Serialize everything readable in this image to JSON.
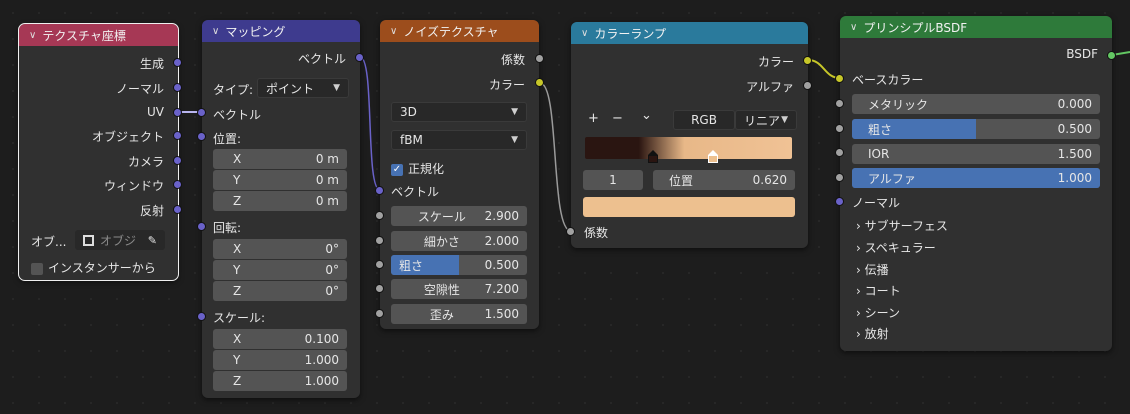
{
  "texcoord": {
    "title": "テクスチャ座標",
    "color": "#a63855",
    "outputs": [
      "生成",
      "ノーマル",
      "UV",
      "オブジェクト",
      "カメラ",
      "ウィンドウ",
      "反射"
    ],
    "object_label": "オブ...",
    "object_placeholder": "オブジ",
    "instancer_label": "インスタンサーから"
  },
  "mapping": {
    "title": "マッピング",
    "color": "#3e3b8e",
    "out_vector": "ベクトル",
    "type_label": "タイプ:",
    "type_value": "ポイント",
    "in_vector": "ベクトル",
    "location_label": "位置:",
    "location": [
      {
        "axis": "X",
        "value": "0 m"
      },
      {
        "axis": "Y",
        "value": "0 m"
      },
      {
        "axis": "Z",
        "value": "0 m"
      }
    ],
    "rotation_label": "回転:",
    "rotation": [
      {
        "axis": "X",
        "value": "0°"
      },
      {
        "axis": "Y",
        "value": "0°"
      },
      {
        "axis": "Z",
        "value": "0°"
      }
    ],
    "scale_label": "スケール:",
    "scale": [
      {
        "axis": "X",
        "value": "0.100"
      },
      {
        "axis": "Y",
        "value": "1.000"
      },
      {
        "axis": "Z",
        "value": "1.000"
      }
    ]
  },
  "noise": {
    "title": "ノイズテクスチャ",
    "color": "#9c4d1c",
    "out_fac": "係数",
    "out_color": "カラー",
    "dim": "3D",
    "type": "fBM",
    "normalize_label": "正規化",
    "in_vector": "ベクトル",
    "fields": [
      {
        "label": "スケール",
        "value": "2.900"
      },
      {
        "label": "細かさ",
        "value": "2.000"
      },
      {
        "label": "粗さ",
        "value": "0.500",
        "fill": 0.5
      },
      {
        "label": "空隙性",
        "value": "7.200"
      },
      {
        "label": "歪み",
        "value": "1.500"
      }
    ]
  },
  "ramp": {
    "title": "カラーランプ",
    "color": "#2a7a9c",
    "out_color": "カラー",
    "out_alpha": "アルファ",
    "btn_add": "+",
    "btn_remove": "−",
    "btn_menu": "⌄",
    "mode": "RGB",
    "interp": "リニア",
    "stop_index": "1",
    "pos_label": "位置",
    "pos_value": "0.620",
    "stop_color": "#edc08f",
    "in_fac": "係数"
  },
  "bsdf": {
    "title": "プリンシプルBSDF",
    "color": "#2e7a3a",
    "out_bsdf": "BSDF",
    "in_base": "ベースカラー",
    "fields": [
      {
        "label": "メタリック",
        "value": "0.000",
        "fill": 0
      },
      {
        "label": "粗さ",
        "value": "0.500",
        "fill": 0.5
      },
      {
        "label": "IOR",
        "value": "1.500",
        "fill": 0
      },
      {
        "label": "アルファ",
        "value": "1.000",
        "fill": 1
      }
    ],
    "normal": "ノーマル",
    "panels": [
      "サブサーフェス",
      "スペキュラー",
      "伝播",
      "コート",
      "シーン",
      "放射"
    ]
  }
}
